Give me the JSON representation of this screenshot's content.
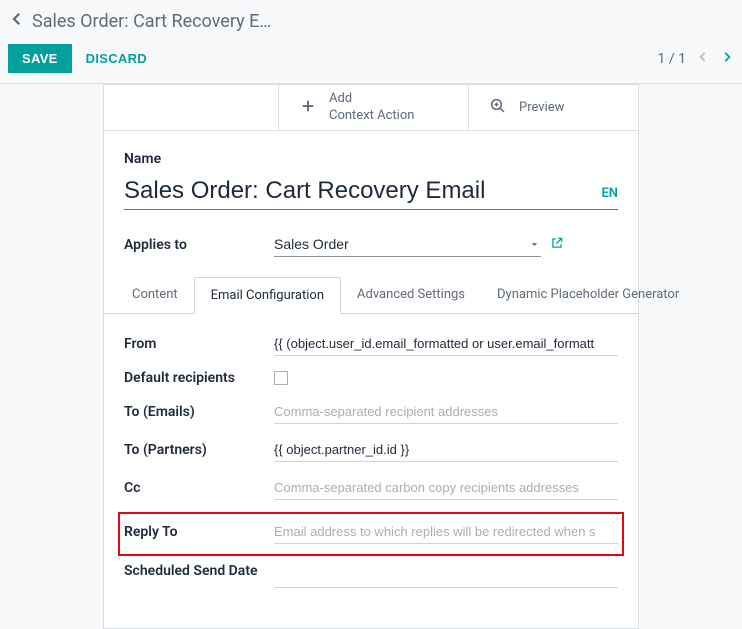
{
  "breadcrumb": {
    "title": "Sales Order: Cart Recovery E…"
  },
  "actions": {
    "save": "SAVE",
    "discard": "DISCARD"
  },
  "pager": {
    "text": "1 / 1"
  },
  "toolbar": {
    "add_top": "Add",
    "add_bottom": "Context Action",
    "preview": "Preview"
  },
  "form": {
    "name_label": "Name",
    "name_value": "Sales Order: Cart Recovery Email",
    "lang": "EN",
    "applies_label": "Applies to",
    "applies_value": "Sales Order"
  },
  "tabs": {
    "content": "Content",
    "email_config": "Email Configuration",
    "advanced": "Advanced Settings",
    "dynamic": "Dynamic Placeholder Generator"
  },
  "fields": {
    "from_label": "From",
    "from_value": "{{ (object.user_id.email_formatted or user.email_formatt",
    "default_recipients_label": "Default recipients",
    "to_emails_label": "To (Emails)",
    "to_emails_placeholder": "Comma-separated recipient addresses",
    "to_partners_label": "To (Partners)",
    "to_partners_value": "{{ object.partner_id.id }}",
    "cc_label": "Cc",
    "cc_placeholder": "Comma-separated carbon copy recipients addresses",
    "reply_to_label": "Reply To",
    "reply_to_placeholder": "Email address to which replies will be redirected when s",
    "scheduled_label": "Scheduled Send Date"
  }
}
